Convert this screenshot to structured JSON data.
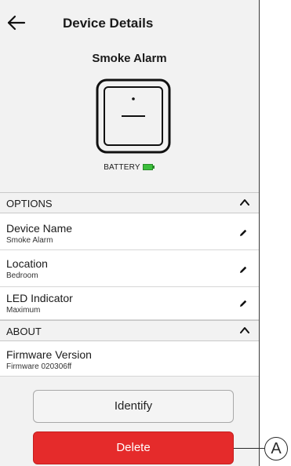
{
  "header": {
    "title": "Device Details"
  },
  "device": {
    "name": "Smoke Alarm",
    "battery_label": "BATTERY"
  },
  "options": {
    "header": "OPTIONS",
    "items": [
      {
        "label": "Device Name",
        "value": "Smoke Alarm"
      },
      {
        "label": "Location",
        "value": "Bedroom"
      },
      {
        "label": "LED Indicator",
        "value": "Maximum"
      }
    ]
  },
  "about": {
    "header": "ABOUT",
    "items": [
      {
        "label": "Firmware Version",
        "value": "Firmware 020306ff"
      }
    ]
  },
  "buttons": {
    "identify": "Identify",
    "delete": "Delete"
  },
  "callout": {
    "label": "A"
  },
  "colors": {
    "delete": "#e52b2b",
    "battery": "#3cbf3c",
    "background": "#f2f2f2"
  },
  "icons": [
    "back-arrow-icon",
    "smoke-alarm-device-icon",
    "battery-icon",
    "chevron-up-icon",
    "pencil-icon"
  ]
}
